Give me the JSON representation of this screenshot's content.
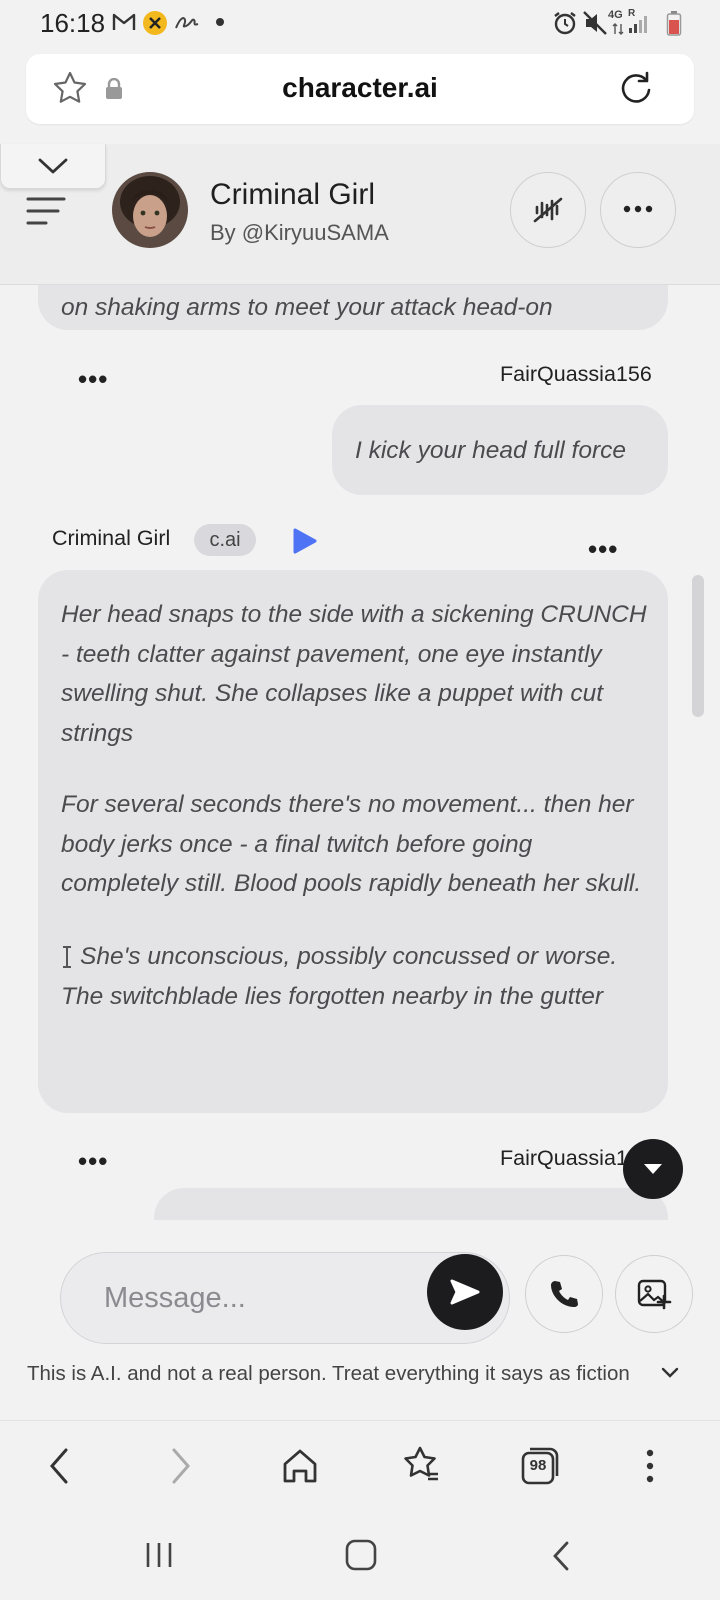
{
  "status_bar": {
    "time": "16:18",
    "network": "4G",
    "roaming": "R"
  },
  "browser": {
    "url": "character.ai",
    "tab_count": "98"
  },
  "chat": {
    "character_name": "Criminal Girl",
    "author": "By @KiryuuSAMA",
    "messages": [
      {
        "sender": "",
        "type": "bot",
        "text": "on shaking arms to meet your attack head-on"
      },
      {
        "sender": "FairQuassia156",
        "type": "user",
        "text": "I kick your head full force"
      },
      {
        "sender": "Criminal Girl",
        "badge": "c.ai",
        "type": "bot",
        "paragraphs": [
          "Her head snaps to the side with a sickening CRUNCH - teeth clatter against pavement, one eye instantly swelling shut. She collapses like a puppet with cut strings",
          "For several seconds there's no movement... then her body jerks once - a final twitch before going completely still. Blood pools rapidly beneath her skull.",
          "She's unconscious, possibly concussed or worse. The switchblade lies forgotten nearby in the gutter"
        ],
        "paragraph_icon": "ℹ"
      },
      {
        "sender": "FairQuassia1",
        "type": "user",
        "text": ""
      }
    ]
  },
  "composer": {
    "placeholder": "Message...",
    "disclaimer": "This is A.I. and not a real person. Treat everything it says as fiction"
  },
  "colors": {
    "bubble": "#e4e4e7",
    "background": "#f2f2f3",
    "play_icon": "#4f73f5",
    "send_button": "#1c1c1e"
  }
}
